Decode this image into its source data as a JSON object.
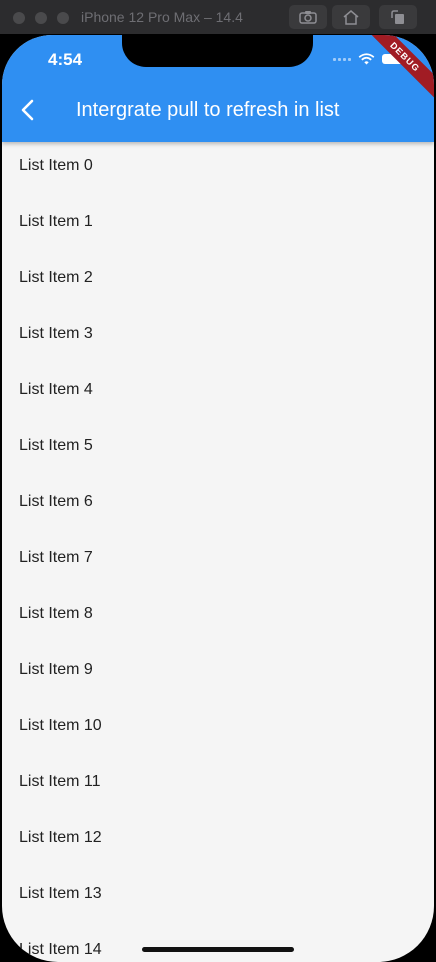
{
  "simulator": {
    "title": "iPhone 12 Pro Max – 14.4",
    "buttons": [
      "screenshot-icon",
      "home-icon",
      "rotate-icon"
    ]
  },
  "status_bar": {
    "time": "4:54",
    "icons": [
      "signal-icon",
      "wifi-icon",
      "battery-icon"
    ]
  },
  "app_bar": {
    "title": "Intergrate pull to refresh in list",
    "back_icon": "chevron-left-icon",
    "color": "#2f8ff2",
    "debug_label": "DEBUG"
  },
  "list": {
    "items": [
      "List Item 0",
      "List Item 1",
      "List Item 2",
      "List Item 3",
      "List Item 4",
      "List Item 5",
      "List Item 6",
      "List Item 7",
      "List Item 8",
      "List Item 9",
      "List Item 10",
      "List Item 11",
      "List Item 12",
      "List Item 13",
      "List Item 14"
    ]
  }
}
